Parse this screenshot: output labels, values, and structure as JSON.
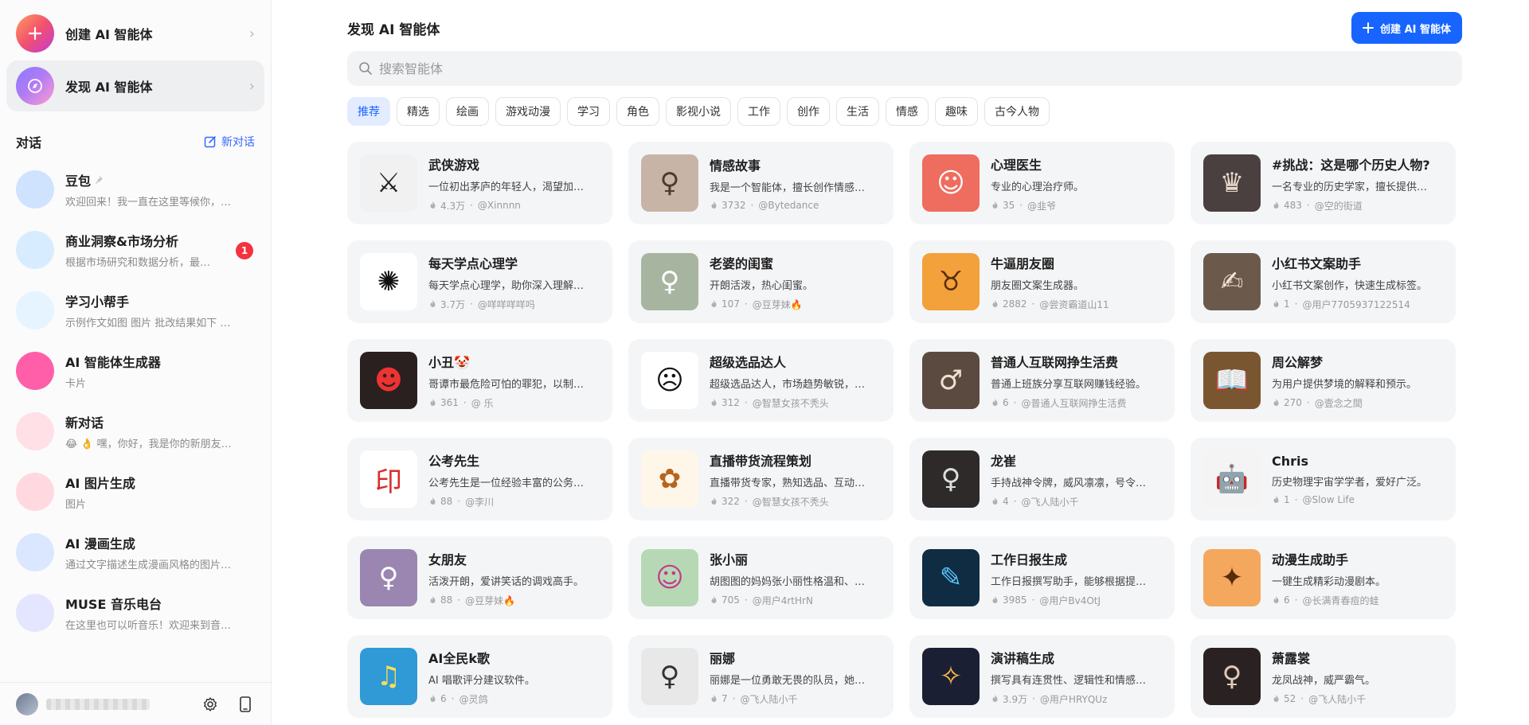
{
  "sidebar": {
    "create_label": "创建 AI 智能体",
    "discover_label": "发现 AI 智能体",
    "conv_title": "对话",
    "new_conv_label": "新对话",
    "conversations": [
      {
        "name": "豆包",
        "sub": "欢迎回来！我一直在这里等候你，…",
        "pinned": true,
        "badge": "",
        "color": "#cfe3ff",
        "icon": "doubao-avatar"
      },
      {
        "name": "商业洞察&市场分析",
        "sub": "根据市场研究和数据分析，最…",
        "pinned": false,
        "badge": "1",
        "color": "#d8ecff",
        "icon": "city-chart-avatar"
      },
      {
        "name": "学习小帮手",
        "sub": "示例作文如图 图片 批改结果如下 …",
        "pinned": false,
        "badge": "",
        "color": "#e6f4ff",
        "icon": "study-girl-avatar"
      },
      {
        "name": "AI 智能体生成器",
        "sub": "卡片",
        "pinned": false,
        "badge": "",
        "color": "#ff5fa8",
        "icon": "gradient-orb-avatar"
      },
      {
        "name": "新对话",
        "sub": "😂 👌 嘿，你好，我是你的新朋友…",
        "pinned": false,
        "badge": "",
        "color": "#ffe0e6",
        "icon": "chat-bubble-avatar"
      },
      {
        "name": "AI 图片生成",
        "sub": "图片",
        "pinned": false,
        "badge": "",
        "color": "#ffd9df",
        "icon": "palette-avatar"
      },
      {
        "name": "AI 漫画生成",
        "sub": "通过文字描述生成漫画风格的图片…",
        "pinned": false,
        "badge": "",
        "color": "#dbe7ff",
        "icon": "comic-burst-avatar"
      },
      {
        "name": "MUSE 音乐电台",
        "sub": "在这里也可以听音乐！欢迎来到音…",
        "pinned": false,
        "badge": "",
        "color": "#e4e6ff",
        "icon": "music-note-avatar"
      }
    ]
  },
  "main": {
    "title": "发现 AI 智能体",
    "create_button": "创建 AI 智能体",
    "search_placeholder": "搜索智能体",
    "tags": [
      "推荐",
      "精选",
      "绘画",
      "游戏动漫",
      "学习",
      "角色",
      "影视小说",
      "工作",
      "创作",
      "生活",
      "情感",
      "趣味",
      "古今人物"
    ],
    "active_tag": "推荐",
    "cards": [
      {
        "title": "武侠游戏",
        "desc": "一位初出茅庐的年轻人，渴望加…",
        "count": "4.3万",
        "author": "@Xinnnn",
        "bg": "#f1f1f1",
        "fg": "#222",
        "glyph": "⚔"
      },
      {
        "title": "情感故事",
        "desc": "我是一个智能体，擅长创作情感…",
        "count": "3732",
        "author": "@Bytedance",
        "bg": "#c8b4a6",
        "fg": "#4b3a30",
        "glyph": "♀"
      },
      {
        "title": "心理医生",
        "desc": "专业的心理治疗师。",
        "count": "35",
        "author": "@韭爷",
        "bg": "#ee6d5f",
        "fg": "#fff",
        "glyph": "☺"
      },
      {
        "title": "#挑战：这是哪个历史人物?",
        "desc": "一名专业的历史学家，擅长提供…",
        "count": "483",
        "author": "@空的街道",
        "bg": "#4a4040",
        "fg": "#e8d9c8",
        "glyph": "♛"
      },
      {
        "title": "每天学点心理学",
        "desc": "每天学点心理学，助你深入理解…",
        "count": "3.7万",
        "author": "@咩咩咩咩吗",
        "bg": "#ffffff",
        "fg": "#111",
        "glyph": "✺"
      },
      {
        "title": "老婆的闺蜜",
        "desc": "开朗活泼，热心闺蜜。",
        "count": "107",
        "author": "@豆芽妹🔥",
        "bg": "#a7b5a0",
        "fg": "#fff",
        "glyph": "♀"
      },
      {
        "title": "牛逼朋友圈",
        "desc": "朋友圈文案生成器。",
        "count": "2882",
        "author": "@尝资霸道山11",
        "bg": "#f2a13b",
        "fg": "#5a2c0f",
        "glyph": "♉"
      },
      {
        "title": "小红书文案助手",
        "desc": "小红书文案创作，快速生成标签。",
        "count": "1",
        "author": "@用户7705937122514",
        "bg": "#6b5a4c",
        "fg": "#f3e6d4",
        "glyph": "✍"
      },
      {
        "title": "小丑🤡",
        "desc": "哥谭市最危险可怕的罪犯，以制…",
        "count": "361",
        "author": "@ 乐",
        "bg": "#2a2020",
        "fg": "#e33",
        "glyph": "☻"
      },
      {
        "title": "超级选品达人",
        "desc": "超级选品达人，市场趋势敏锐，…",
        "count": "312",
        "author": "@智慧女孩不秃头",
        "bg": "#ffffff",
        "fg": "#111",
        "glyph": "☹"
      },
      {
        "title": "普通人互联网挣生活费",
        "desc": "普通上班族分享互联网赚钱经验。",
        "count": "6",
        "author": "@普通人互联网挣生活费",
        "bg": "#5b4a40",
        "fg": "#f0e0d0",
        "glyph": "♂"
      },
      {
        "title": "周公解梦",
        "desc": "为用户提供梦境的解释和预示。",
        "count": "270",
        "author": "@壹念之間",
        "bg": "#7a5630",
        "fg": "#f7e6c2",
        "glyph": "📖"
      },
      {
        "title": "公考先生",
        "desc": "公考先生是一位经验丰富的公务…",
        "count": "88",
        "author": "@李川",
        "bg": "#ffffff",
        "fg": "#d92b2b",
        "glyph": "印"
      },
      {
        "title": "直播带货流程策划",
        "desc": "直播带货专家，熟知选品、互动…",
        "count": "322",
        "author": "@智慧女孩不秃头",
        "bg": "#fff6ea",
        "fg": "#b5651d",
        "glyph": "✿"
      },
      {
        "title": "龙崔",
        "desc": "手持战神令牌，威风凛凛，号令…",
        "count": "4",
        "author": "@飞人陆小千",
        "bg": "#2e2a2a",
        "fg": "#ddd",
        "glyph": "♀"
      },
      {
        "title": "Chris",
        "desc": "历史物理宇宙学学者，爱好广泛。",
        "count": "1",
        "author": "@Slow Life",
        "bg": "#f4f4f4",
        "fg": "#888",
        "glyph": "🤖"
      },
      {
        "title": "女朋友",
        "desc": "活泼开朗，爱讲笑话的调戏高手。",
        "count": "88",
        "author": "@豆芽妹🔥",
        "bg": "#9a86b0",
        "fg": "#fff",
        "glyph": "♀"
      },
      {
        "title": "张小丽",
        "desc": "胡图图的妈妈张小丽性格温和、…",
        "count": "705",
        "author": "@用户4rtHrN",
        "bg": "#b7d8b5",
        "fg": "#c23c8c",
        "glyph": "☺"
      },
      {
        "title": "工作日报生成",
        "desc": "工作日报撰写助手，能够根据提…",
        "count": "3985",
        "author": "@用户Bv4OtJ",
        "bg": "#0f2c43",
        "fg": "#5cc6ff",
        "glyph": "✎"
      },
      {
        "title": "动漫生成助手",
        "desc": "一键生成精彩动漫剧本。",
        "count": "6",
        "author": "@长满青春痘的蛙",
        "bg": "#f3a85d",
        "fg": "#5a2a10",
        "glyph": "✦"
      },
      {
        "title": "AI全民k歌",
        "desc": "AI 唱歌评分建议软件。",
        "count": "6",
        "author": "@灵鸽",
        "bg": "#2f9ad6",
        "fg": "#ffdd55",
        "glyph": "♫"
      },
      {
        "title": "丽娜",
        "desc": "丽娜是一位勇敢无畏的队员，她…",
        "count": "7",
        "author": "@飞人陆小千",
        "bg": "#e8e8e8",
        "fg": "#333",
        "glyph": "♀"
      },
      {
        "title": "演讲稿生成",
        "desc": "撰写具有连贯性、逻辑性和情感…",
        "count": "3.9万",
        "author": "@用户HRYQUz",
        "bg": "#1a1f33",
        "fg": "#ffb84d",
        "glyph": "✧"
      },
      {
        "title": "萧露裳",
        "desc": "龙凤战神，威严霸气。",
        "count": "52",
        "author": "@飞人陆小千",
        "bg": "#2a2222",
        "fg": "#e0c9b5",
        "glyph": "♀"
      }
    ]
  }
}
